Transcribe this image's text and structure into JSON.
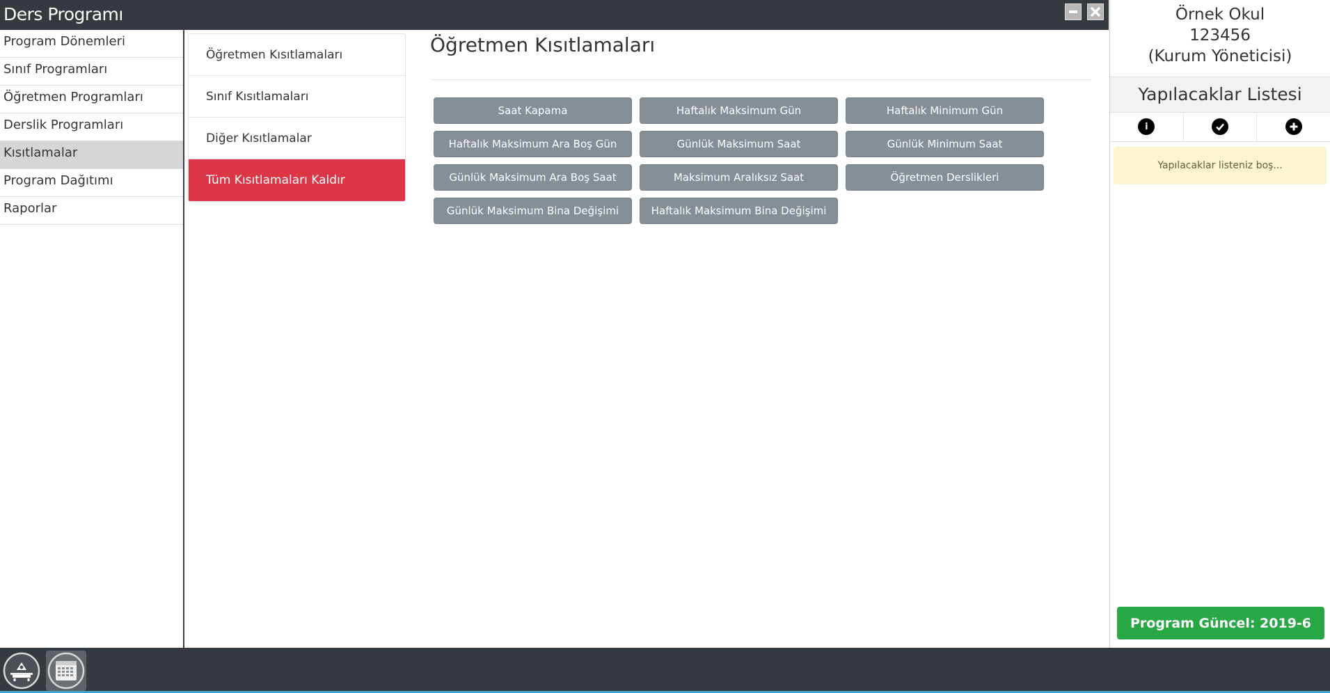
{
  "window": {
    "title": "Ders Programı"
  },
  "sidebar": {
    "items": [
      {
        "label": "Program Dönemleri",
        "active": false
      },
      {
        "label": "Sınıf Programları",
        "active": false
      },
      {
        "label": "Öğretmen Programları",
        "active": false
      },
      {
        "label": "Derslik Programları",
        "active": false
      },
      {
        "label": "Kısıtlamalar",
        "active": true
      },
      {
        "label": "Program Dağıtımı",
        "active": false
      },
      {
        "label": "Raporlar",
        "active": false
      }
    ]
  },
  "submenu": {
    "items": [
      {
        "label": "Öğretmen Kısıtlamaları"
      },
      {
        "label": "Sınıf Kısıtlamaları"
      },
      {
        "label": "Diğer Kısıtlamalar"
      },
      {
        "label": "Tüm Kısıtlamaları Kaldır",
        "style": "danger"
      }
    ]
  },
  "main": {
    "title": "Öğretmen Kısıtlamaları",
    "buttons": [
      "Saat Kapama",
      "Haftalık Maksimum Gün",
      "Haftalık Minimum Gün",
      "Haftalık Maksimum Ara Boş Gün",
      "Günlük Maksimum Saat",
      "Günlük Minimum Saat",
      "Günlük Maksimum Ara Boş Saat",
      "Maksimum Aralıksız Saat",
      "Öğretmen Derslikleri",
      "Günlük Maksimum Bina Değişimi",
      "Haftalık Maksimum Bina Değişimi"
    ]
  },
  "right_panel": {
    "school_name": "Örnek Okul",
    "school_code": "123456",
    "role": "(Kurum Yöneticisi)",
    "todo_title": "Yapılacaklar Listesi",
    "todo_tools": [
      "info-icon",
      "check-icon",
      "plus-icon"
    ],
    "todo_empty": "Yapılacaklar listeniz boş...",
    "program_status": "Program Güncel: 2019-6"
  },
  "colors": {
    "titlebar": "#343a40",
    "danger": "#dc3545",
    "success": "#28a745",
    "secondary": "#868e96",
    "warning_bg": "#fcf3d2"
  }
}
